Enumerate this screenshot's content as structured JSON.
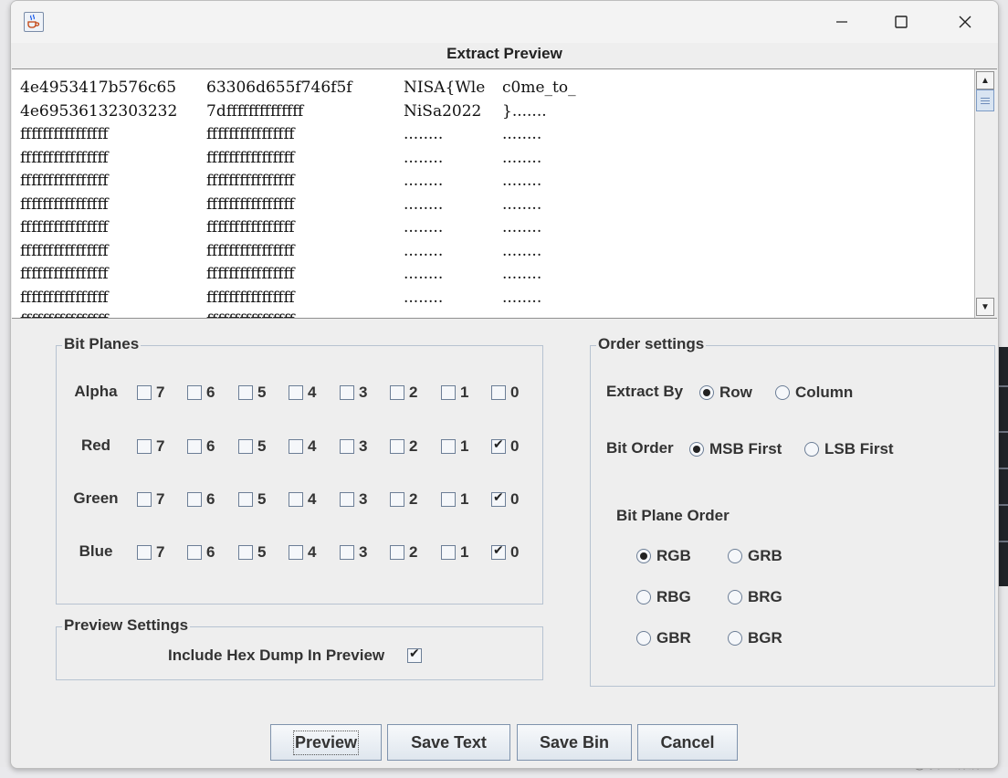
{
  "window": {
    "title": "Extract Preview",
    "app_icon": "java-cup-icon",
    "controls": [
      "minimize-icon",
      "maximize-icon",
      "close-icon"
    ]
  },
  "preview": {
    "lines": [
      {
        "hex1": "4e4953417b576c65",
        "hex2": "63306d655f746f5f",
        "ascii1": "NISA{Wle",
        "ascii2": "c0me_to_"
      },
      {
        "hex1": "4e69536132303232",
        "hex2": "7dffffffffffffff",
        "ascii1": "NiSa2022",
        "ascii2": "}......."
      },
      {
        "hex1": "ffffffffffffffff",
        "hex2": "ffffffffffffffff",
        "ascii1": "........",
        "ascii2": "........"
      },
      {
        "hex1": "ffffffffffffffff",
        "hex2": "ffffffffffffffff",
        "ascii1": "........",
        "ascii2": "........"
      },
      {
        "hex1": "ffffffffffffffff",
        "hex2": "ffffffffffffffff",
        "ascii1": "........",
        "ascii2": "........"
      },
      {
        "hex1": "ffffffffffffffff",
        "hex2": "ffffffffffffffff",
        "ascii1": "........",
        "ascii2": "........"
      },
      {
        "hex1": "ffffffffffffffff",
        "hex2": "ffffffffffffffff",
        "ascii1": "........",
        "ascii2": "........"
      },
      {
        "hex1": "ffffffffffffffff",
        "hex2": "ffffffffffffffff",
        "ascii1": "........",
        "ascii2": "........"
      },
      {
        "hex1": "ffffffffffffffff",
        "hex2": "ffffffffffffffff",
        "ascii1": "........",
        "ascii2": "........"
      },
      {
        "hex1": "ffffffffffffffff",
        "hex2": "ffffffffffffffff",
        "ascii1": "........",
        "ascii2": "........"
      },
      {
        "hex1": "ffffffffffffffff",
        "hex2": "ffffffffffffffff",
        "ascii1": "........",
        "ascii2": "........"
      }
    ]
  },
  "bit_planes": {
    "title": "Bit Planes",
    "bits": [
      "7",
      "6",
      "5",
      "4",
      "3",
      "2",
      "1",
      "0"
    ],
    "rows": [
      {
        "label": "Alpha",
        "checked": [
          false,
          false,
          false,
          false,
          false,
          false,
          false,
          false
        ]
      },
      {
        "label": "Red",
        "checked": [
          false,
          false,
          false,
          false,
          false,
          false,
          false,
          true
        ]
      },
      {
        "label": "Green",
        "checked": [
          false,
          false,
          false,
          false,
          false,
          false,
          false,
          true
        ]
      },
      {
        "label": "Blue",
        "checked": [
          false,
          false,
          false,
          false,
          false,
          false,
          false,
          true
        ]
      }
    ]
  },
  "preview_settings": {
    "title": "Preview Settings",
    "hex_dump_label": "Include Hex Dump In Preview",
    "hex_dump_checked": true
  },
  "order_settings": {
    "title": "Order settings",
    "extract_by_label": "Extract By",
    "extract_by_options": [
      "Row",
      "Column"
    ],
    "extract_by_selected": "Row",
    "bit_order_label": "Bit Order",
    "bit_order_options": [
      "MSB First",
      "LSB First"
    ],
    "bit_order_selected": "MSB First",
    "plane_order_label": "Bit Plane Order",
    "plane_order_options": [
      "RGB",
      "GRB",
      "RBG",
      "BRG",
      "GBR",
      "BGR"
    ],
    "plane_order_selected": "RGB"
  },
  "buttons": {
    "preview": "Preview",
    "save_text": "Save Text",
    "save_bin": "Save Bin",
    "cancel": "Cancel"
  },
  "background": {
    "watermark": "CSDN @羡鱼饼饼"
  }
}
